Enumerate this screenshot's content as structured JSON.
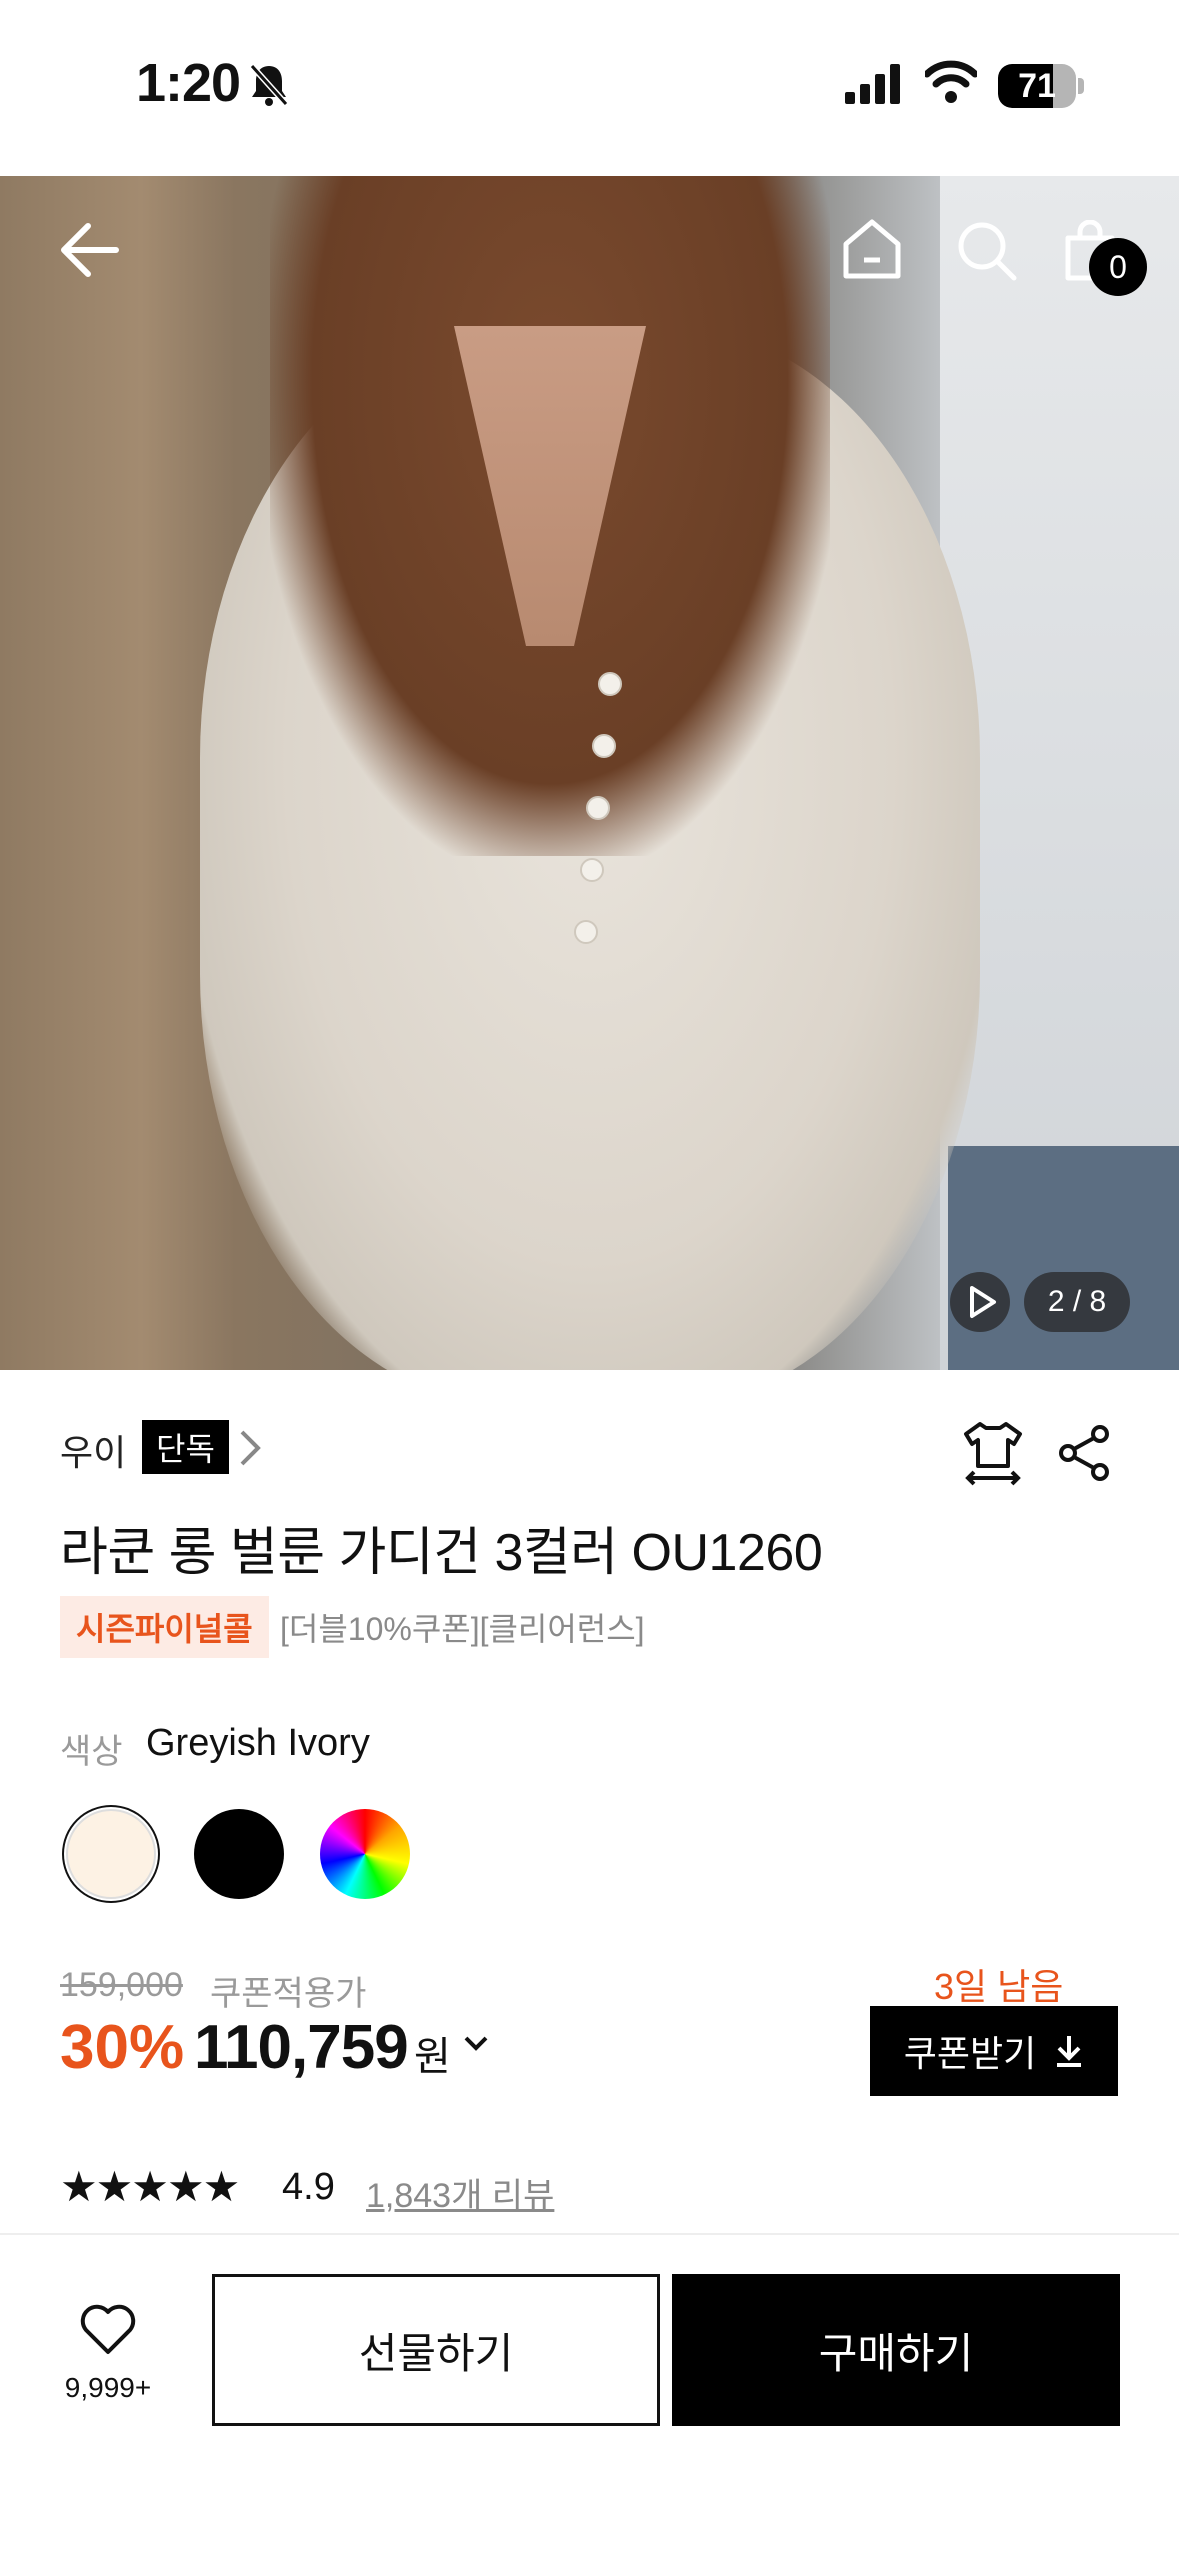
{
  "status": {
    "time": "1:20",
    "battery": "71",
    "battery_level": 0.71
  },
  "hero": {
    "page_indicator": "2 / 8",
    "cart_count": "0"
  },
  "product": {
    "brand": "우이",
    "exclusive_badge": "단독",
    "title": "라쿤 롱 벌룬 가디건 3컬러 OU1260",
    "promo_tag": "시즌파이널콜",
    "promo_text": "[더블10%쿠폰][클리어런스]",
    "color_label": "색상",
    "color_value": "Greyish Ivory",
    "swatches": [
      {
        "name": "greyish-ivory",
        "color": "#fdf2e4",
        "selected": true
      },
      {
        "name": "black",
        "color": "#000000",
        "selected": false
      },
      {
        "name": "multicolor",
        "color": "rainbow",
        "selected": false
      }
    ]
  },
  "price": {
    "original": "159,000",
    "coupon_label": "쿠폰적용가",
    "discount": "30%",
    "final": "110,759",
    "currency": "원",
    "days_left": "3일 남음",
    "coupon_button": "쿠폰받기"
  },
  "review": {
    "stars": "★★★★★",
    "rating": "4.9",
    "count_label": "1,843개 리뷰"
  },
  "bottom": {
    "like_count": "9,999+",
    "gift_label": "선물하기",
    "buy_label": "구매하기"
  },
  "colors": {
    "accent": "#e8541c",
    "primary": "#000000"
  }
}
